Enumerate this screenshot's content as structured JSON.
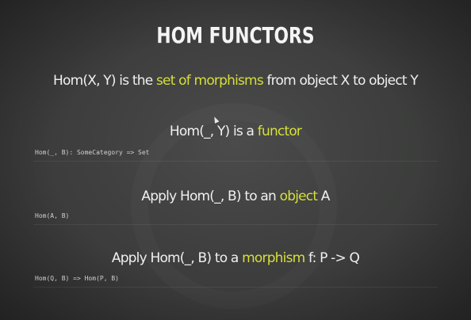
{
  "slide": {
    "title": "HOM FUNCTORS",
    "line1": {
      "pre": "Hom(X, Y) is the ",
      "highlight": "set of morphisms",
      "post": " from object X to object Y"
    },
    "line2": {
      "pre": "Hom(_, Y) is a ",
      "highlight": "functor"
    },
    "code1": "Hom(_, B): SomeCategory => Set",
    "line3": {
      "pre": "Apply Hom(_, B) to an ",
      "highlight": "object",
      "post": " A"
    },
    "code2": "Hom(A, B)",
    "line4": {
      "pre": "Apply Hom(_, B) to a ",
      "highlight": "morphism",
      "post": " f: P -> Q"
    },
    "code3": "Hom(Q, B) => Hom(P, B)"
  },
  "colors": {
    "background": "#3e3f3e",
    "text": "#f0f0f0",
    "highlight": "#d8df3a"
  }
}
